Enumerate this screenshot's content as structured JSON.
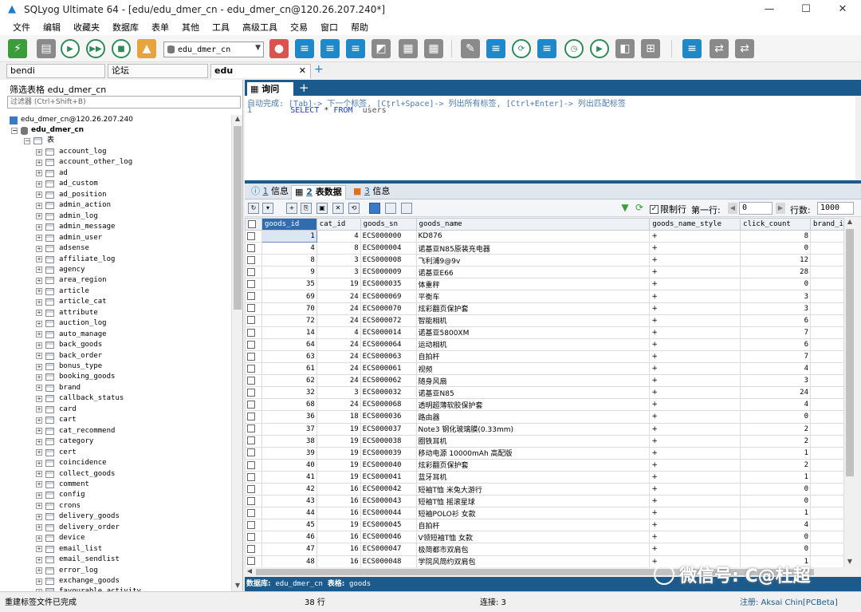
{
  "window": {
    "title": "SQLyog Ultimate 64 - [edu/edu_dmer_cn - edu_dmer_cn@120.26.207.240*]",
    "buttons": [
      "—",
      "☐",
      "✕"
    ]
  },
  "menu": [
    "文件",
    "编辑",
    "收藏夹",
    "数据库",
    "表单",
    "其他",
    "工具",
    "高级工具",
    "交易",
    "窗口",
    "帮助"
  ],
  "toolbar": {
    "database_select": "edu_dmer_cn",
    "icons": [
      "new-connection-icon",
      "new-query-icon",
      "execute-query-icon",
      "execute-all-icon",
      "stop-icon",
      "schema-designer-icon",
      "user-manager-icon",
      "create-database-icon",
      "backup-icon",
      "restore-icon",
      "import-icon",
      "export-icon",
      "table-data-icon",
      "history-icon",
      "refresh-icon",
      "sync-icon",
      "scheduled-icon",
      "copy-database-icon",
      "data-sync-icon",
      "query-builder-icon",
      "schema-sync-icon",
      "migration-icon",
      "notification-icon"
    ]
  },
  "connection_tabs": [
    {
      "label": "bendi",
      "active": false
    },
    {
      "label": "论坛",
      "active": false
    },
    {
      "label": "edu",
      "active": true
    }
  ],
  "object_browser": {
    "filter_label": "筛选表格 edu_dmer_cn",
    "filter_placeholder": "过滤器 (Ctrl+Shift+B)",
    "server": "edu_dmer_cn@120.26.207.240",
    "database": "edu_dmer_cn",
    "tables_folder": "表",
    "tables": [
      "account_log",
      "account_other_log",
      "ad",
      "ad_custom",
      "ad_position",
      "admin_action",
      "admin_log",
      "admin_message",
      "admin_user",
      "adsense",
      "affiliate_log",
      "agency",
      "area_region",
      "article",
      "article_cat",
      "attribute",
      "auction_log",
      "auto_manage",
      "back_goods",
      "back_order",
      "bonus_type",
      "booking_goods",
      "brand",
      "callback_status",
      "card",
      "cart",
      "cat_recommend",
      "category",
      "cert",
      "coincidence",
      "collect_goods",
      "comment",
      "config",
      "crons",
      "delivery_goods",
      "delivery_order",
      "device",
      "email_list",
      "email_sendlist",
      "error_log",
      "exchange_goods",
      "favourable_activity"
    ]
  },
  "query": {
    "tab_label": "询问",
    "autocomplete_hint": "自动完成: [Tab]-> 下一个标签, [Ctrl+Space]-> 列出所有标签, [Ctrl+Enter]-> 列出匹配标签",
    "line_no": "1",
    "sql_keyword1": "SELECT",
    "sql_star": "*",
    "sql_keyword2": "FROM",
    "sql_table": "`users`"
  },
  "result_tabs": [
    {
      "num": "1",
      "label": "信息",
      "active": false
    },
    {
      "num": "2",
      "label": "表数据",
      "active": true
    },
    {
      "num": "3",
      "label": "信息",
      "active": false
    }
  ],
  "grid_toolbar": {
    "limit_label": "限制行",
    "limit_checked": true,
    "first_row_label": "第一行:",
    "first_row_value": "0",
    "rows_label": "行数:",
    "rows_value": "1000"
  },
  "grid": {
    "columns": [
      "goods_id",
      "cat_id",
      "goods_sn",
      "goods_name",
      "goods_name_style",
      "click_count",
      "brand_i"
    ],
    "rows": [
      [
        "1",
        "4",
        "ECS000000",
        "KD876",
        "+",
        "8"
      ],
      [
        "4",
        "8",
        "ECS000004",
        "诺基亚N85原装充电器",
        "+",
        "0"
      ],
      [
        "8",
        "3",
        "ECS000008",
        "飞利浦9@9v",
        "+",
        "12"
      ],
      [
        "9",
        "3",
        "ECS000009",
        "诺基亚E66",
        "+",
        "28"
      ],
      [
        "35",
        "19",
        "ECS000035",
        "体重秤",
        "+",
        "0"
      ],
      [
        "69",
        "24",
        "ECS000069",
        "平衡车",
        "+",
        "3"
      ],
      [
        "70",
        "24",
        "ECS000070",
        "炫彩翻页保护套",
        "+",
        "3"
      ],
      [
        "72",
        "24",
        "ECS000072",
        "智能相机",
        "+",
        "6"
      ],
      [
        "14",
        "4",
        "ECS000014",
        "诺基亚5800XM",
        "+",
        "7"
      ],
      [
        "64",
        "24",
        "ECS000064",
        "运动相机",
        "+",
        "6"
      ],
      [
        "63",
        "24",
        "ECS000063",
        "自拍杆",
        "+",
        "7"
      ],
      [
        "61",
        "24",
        "ECS000061",
        "视频",
        "+",
        "4"
      ],
      [
        "62",
        "24",
        "ECS000062",
        "随身风扇",
        "+",
        "3"
      ],
      [
        "32",
        "3",
        "ECS000032",
        "诺基亚N85",
        "+",
        "24"
      ],
      [
        "68",
        "24",
        "ECS000068",
        "透明超薄软胶保护套",
        "+",
        "4"
      ],
      [
        "36",
        "18",
        "ECS000036",
        "路由器",
        "+",
        "0"
      ],
      [
        "37",
        "19",
        "ECS000037",
        "Note3 钢化玻璃膜(0.33mm)",
        "+",
        "2"
      ],
      [
        "38",
        "19",
        "ECS000038",
        "圈铁耳机",
        "+",
        "2"
      ],
      [
        "39",
        "19",
        "ECS000039",
        "移动电源 10000mAh 高配版",
        "+",
        "1"
      ],
      [
        "40",
        "19",
        "ECS000040",
        " 炫彩翻页保护套",
        "+",
        "2"
      ],
      [
        "41",
        "19",
        "ECS000041",
        "蓝牙耳机",
        "+",
        "1"
      ],
      [
        "42",
        "16",
        "ECS000042",
        "短袖T恤 米兔大游行",
        "+",
        "0"
      ],
      [
        "43",
        "16",
        "ECS000043",
        "短袖T恤 摇滚星球",
        "+",
        "0"
      ],
      [
        "44",
        "16",
        "ECS000044",
        "短袖POLO衫 女款",
        "+",
        "1"
      ],
      [
        "45",
        "19",
        "ECS000045",
        "自拍杆",
        "+",
        "4"
      ],
      [
        "46",
        "16",
        "ECS000046",
        "V领短袖T恤 女款",
        "+",
        "0"
      ],
      [
        "47",
        "16",
        "ECS000047",
        "极简都市双肩包",
        "+",
        "0"
      ],
      [
        "48",
        "16",
        "ECS000048",
        "学院风简约双肩包",
        "+",
        "1"
      ]
    ]
  },
  "db_status": {
    "db_label": "数据库:",
    "db_value": "edu_dmer_cn",
    "table_label": "表格:",
    "table_value": "goods"
  },
  "watermark": "微信号: C@杜超",
  "statusbar": {
    "message": "重建标签文件已完成",
    "rows": "38 行",
    "connection": "连接: 3",
    "registered": "注册: Aksai Chin[PCBeta]"
  }
}
